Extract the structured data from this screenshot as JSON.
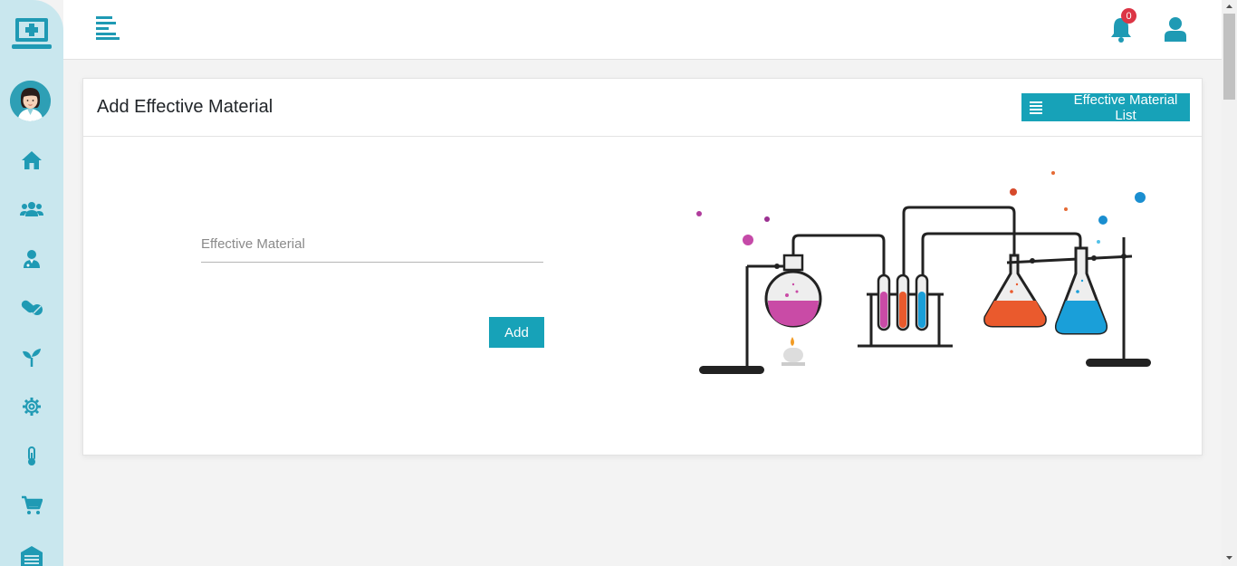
{
  "sidebar": {
    "logo_icon": "medical-laptop-icon",
    "avatar_icon": "doctor-avatar",
    "items": [
      {
        "icon": "home-icon"
      },
      {
        "icon": "users-icon"
      },
      {
        "icon": "doctor-icon"
      },
      {
        "icon": "pills-icon"
      },
      {
        "icon": "plant-icon"
      },
      {
        "icon": "gear-icon"
      },
      {
        "icon": "thermometer-icon"
      },
      {
        "icon": "cart-icon"
      },
      {
        "icon": "warehouse-icon"
      }
    ]
  },
  "topbar": {
    "notification_count": "0"
  },
  "page": {
    "title": "Add Effective Material",
    "list_button_label": "Effective Material List",
    "form": {
      "material_placeholder": "Effective Material",
      "material_value": "",
      "add_button_label": "Add"
    }
  },
  "colors": {
    "accent": "#17a2b8",
    "sidebar_bg": "#c9e7ee",
    "badge": "#dc3545"
  }
}
